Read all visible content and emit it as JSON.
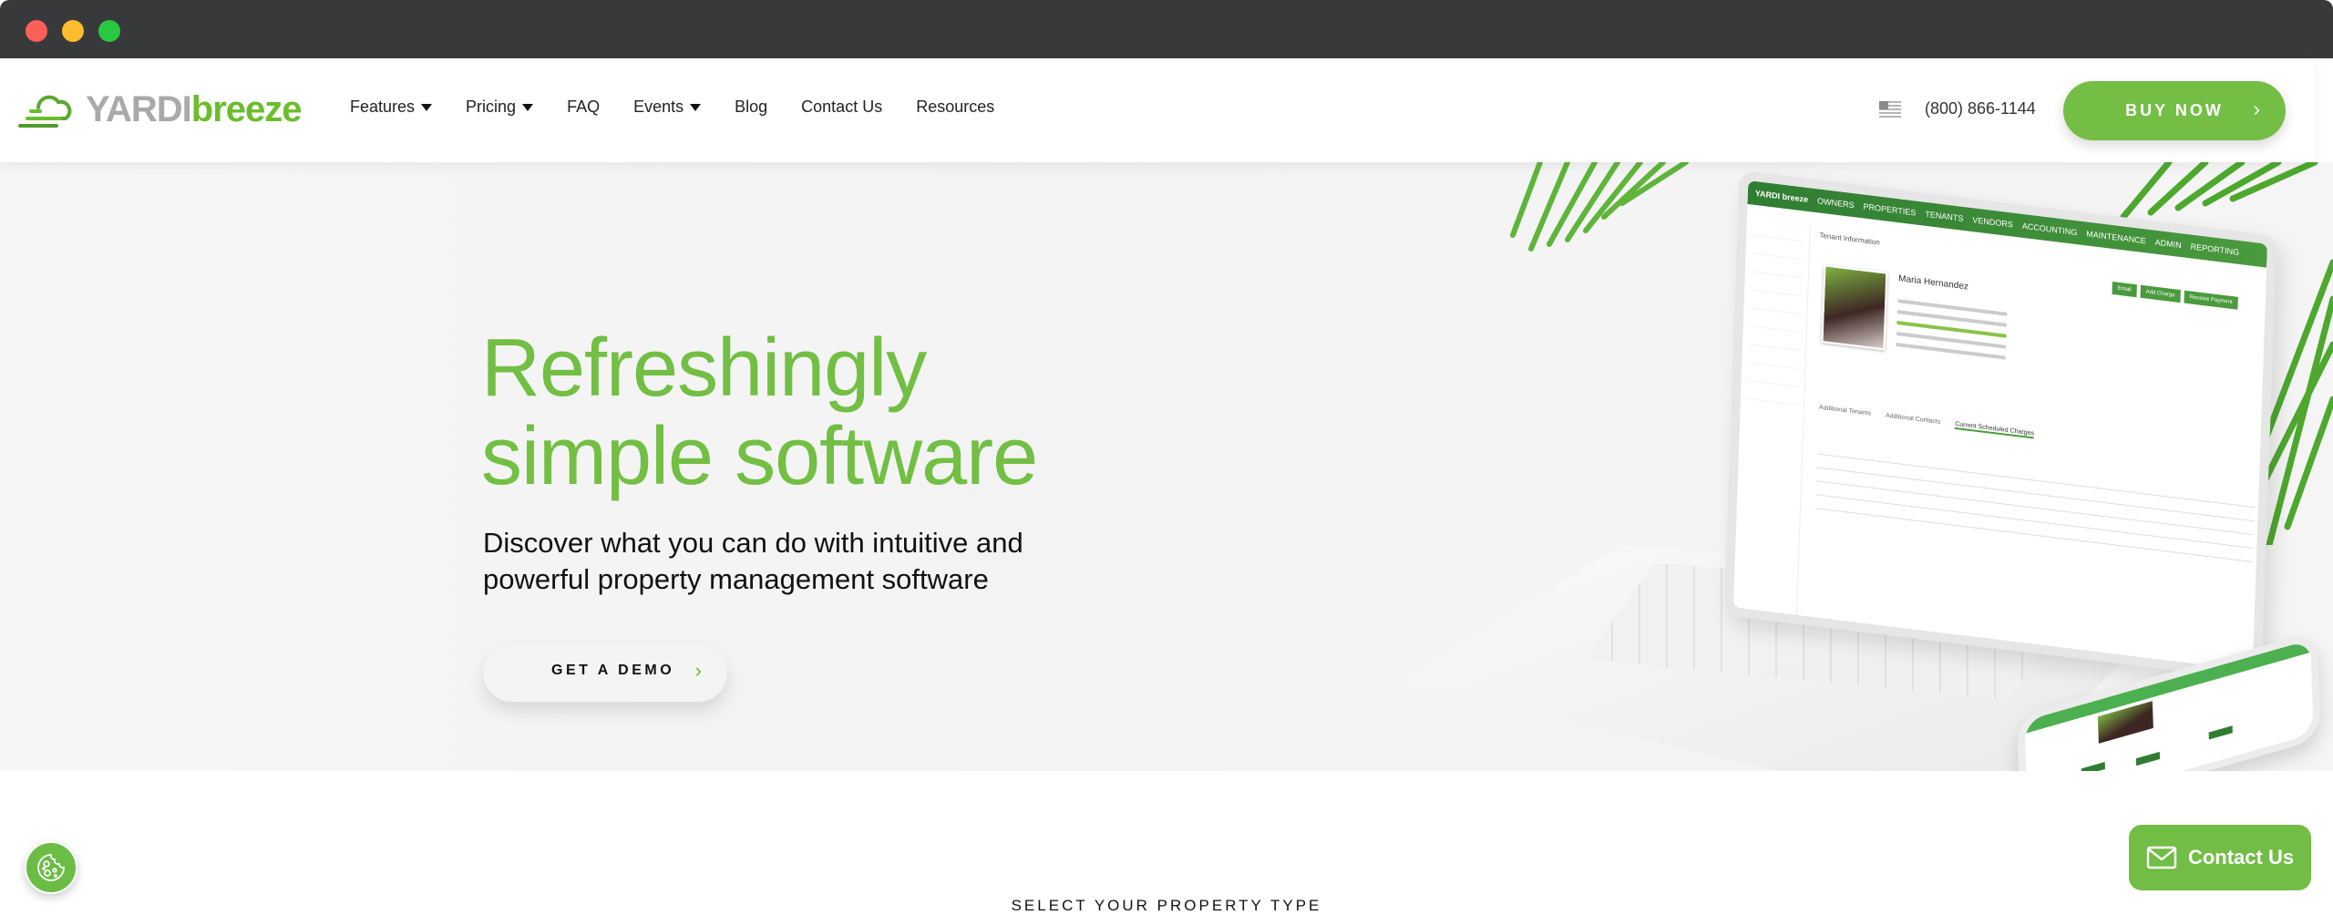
{
  "window": {
    "controls": [
      "close",
      "minimize",
      "maximize"
    ]
  },
  "header": {
    "logo": {
      "brand_primary": "YARDI",
      "brand_secondary": "breeze",
      "icon": "cloud-wind-icon"
    },
    "nav": [
      {
        "label": "Features",
        "has_dropdown": true
      },
      {
        "label": "Pricing",
        "has_dropdown": true
      },
      {
        "label": "FAQ",
        "has_dropdown": false
      },
      {
        "label": "Events",
        "has_dropdown": true
      },
      {
        "label": "Blog",
        "has_dropdown": false
      },
      {
        "label": "Contact Us",
        "has_dropdown": false
      },
      {
        "label": "Resources",
        "has_dropdown": false
      }
    ],
    "region_icon": "us-flag-icon",
    "phone": "(800) 866-1144",
    "buy_now_label": "BUY NOW",
    "buy_now_icon": "chevron-right-icon"
  },
  "hero": {
    "headline_line1": "Refreshingly",
    "headline_line2": "simple software",
    "subtitle_line1": "Discover what you can do with intuitive and",
    "subtitle_line2": "powerful property management software",
    "cta_label": "GET A DEMO",
    "cta_icon": "chevron-right-icon",
    "mockup": {
      "app_nav": [
        "OWNERS",
        "PROPERTIES",
        "TENANTS",
        "VENDORS",
        "ACCOUNTING",
        "MAINTENANCE",
        "ADMIN",
        "REPORTING"
      ],
      "section_title": "Tenant Information",
      "tenant_name": "Maria Hernandez",
      "actions": [
        "Email",
        "Add Charge",
        "Receive Payment"
      ],
      "tabs": [
        "Additional Tenants",
        "Additional Contacts",
        "Current Scheduled Charges"
      ]
    }
  },
  "section": {
    "label": "SELECT YOUR PROPERTY TYPE"
  },
  "floating": {
    "cookie_icon": "cookie-icon",
    "contact_label": "Contact Us",
    "contact_icon": "envelope-icon"
  },
  "colors": {
    "brand_green": "#74be45",
    "logo_gray": "#a7a9ab",
    "titlebar": "#38393b"
  }
}
